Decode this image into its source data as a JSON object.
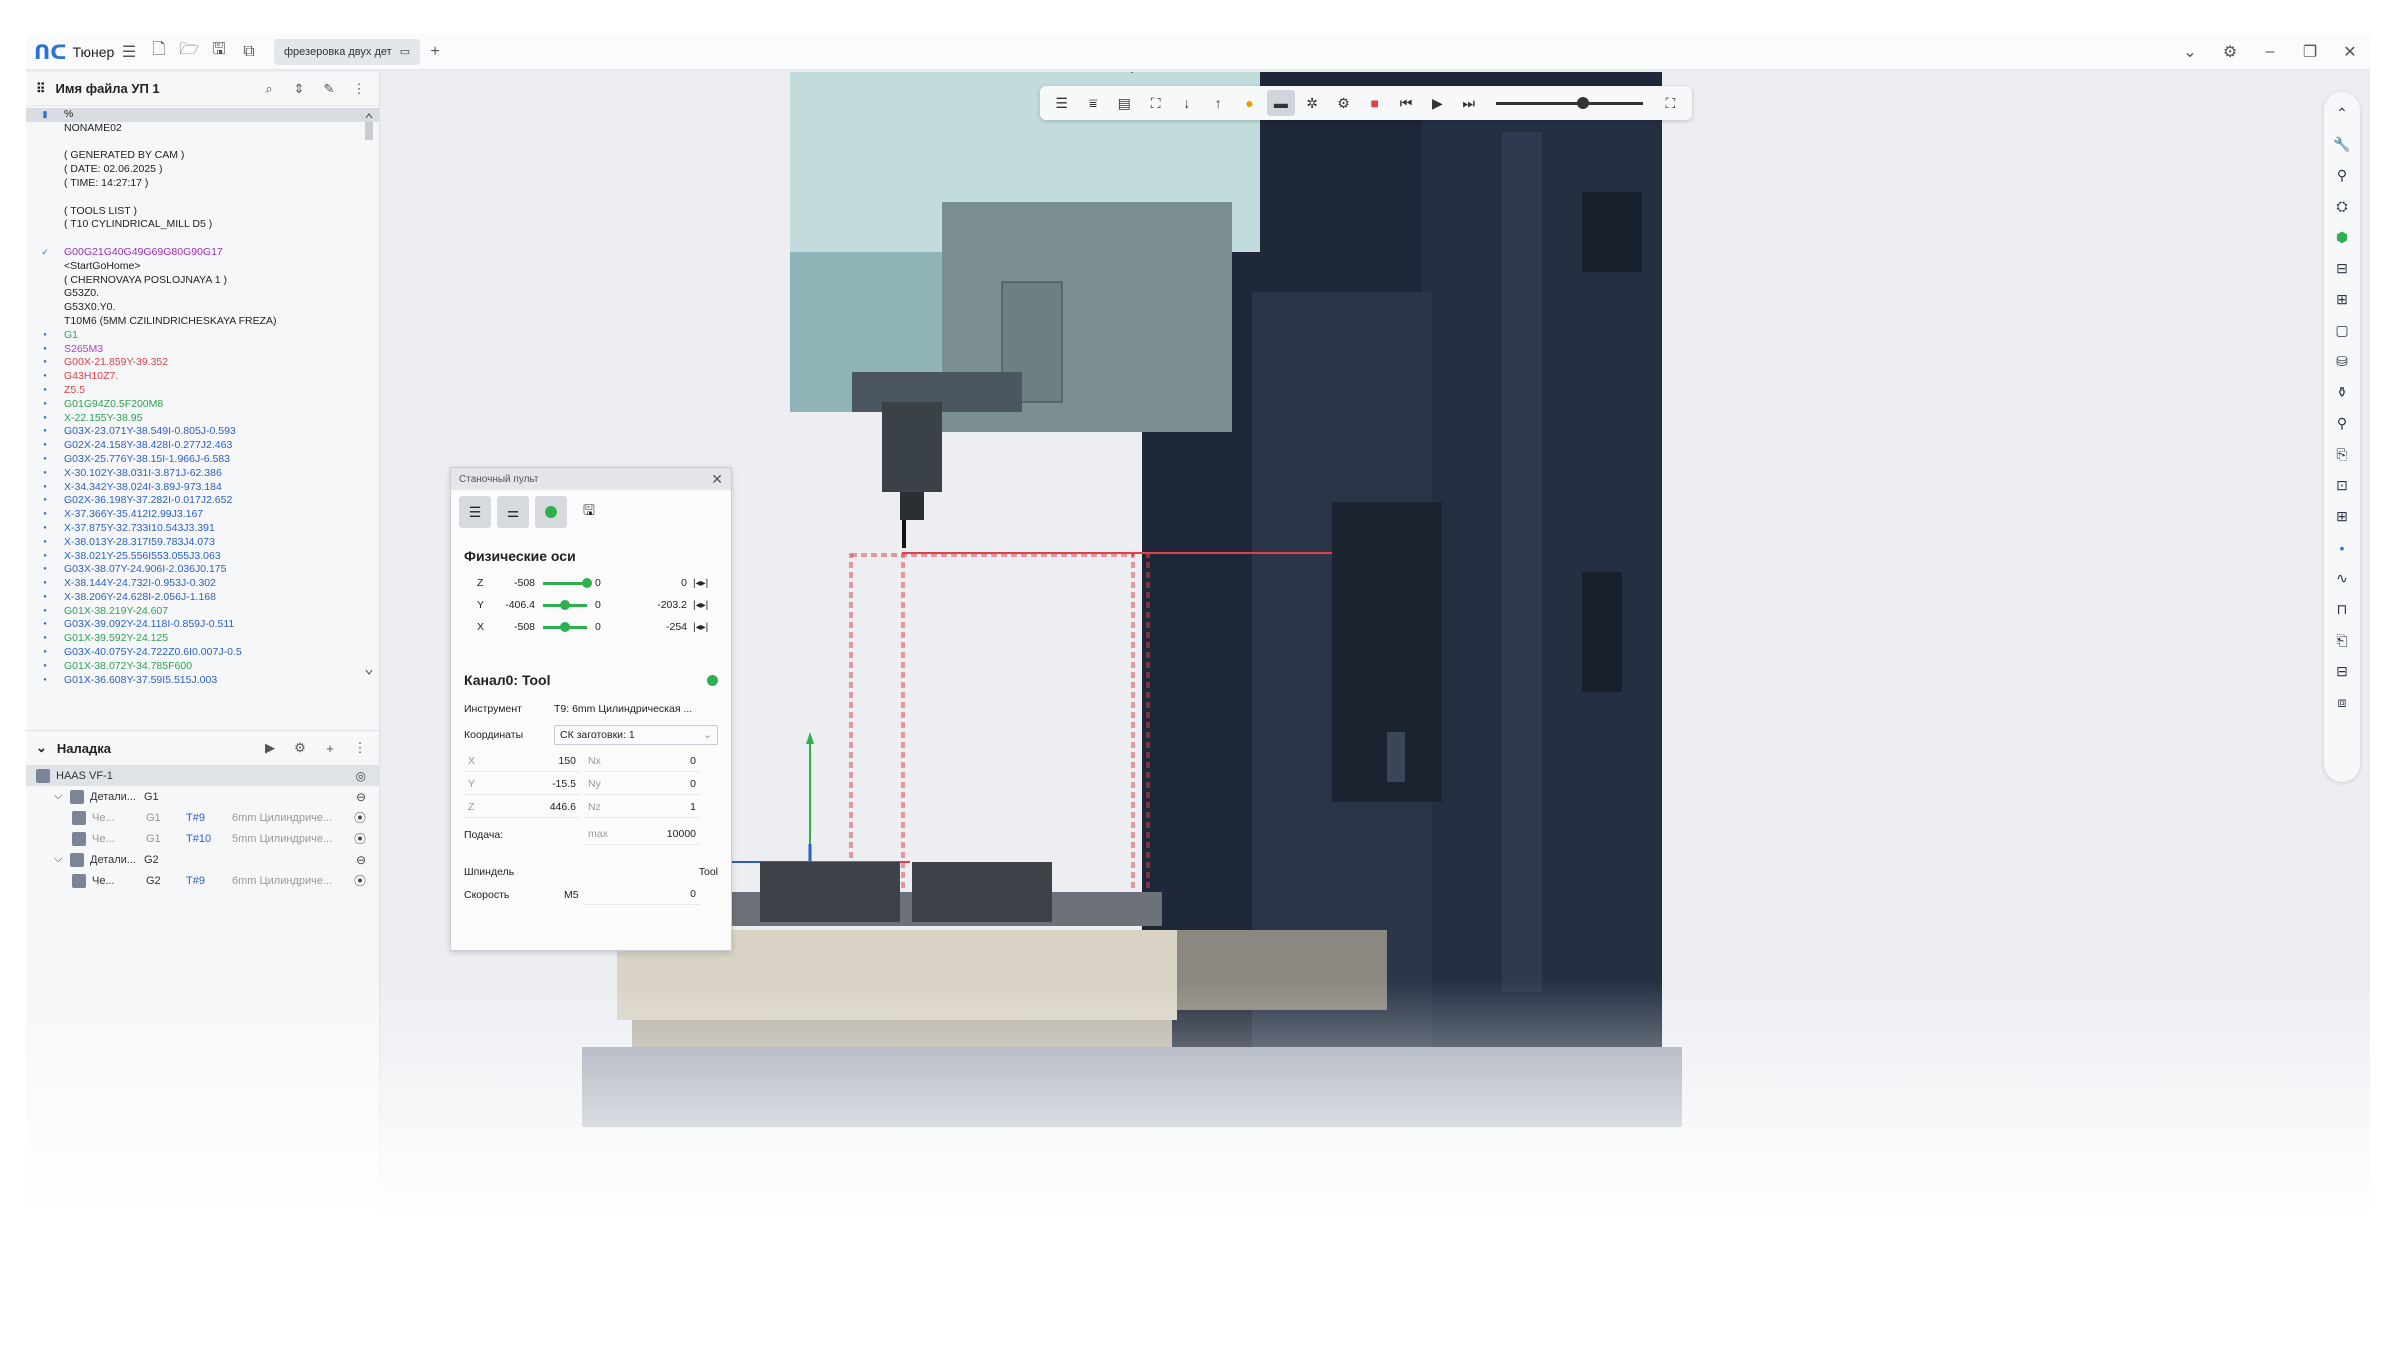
{
  "app": {
    "name": "Тюнер",
    "tab_label": "фрезеровка двух дет"
  },
  "code_panel": {
    "title": "Имя файла УП 1",
    "lines": [
      {
        "text": "%",
        "color": "#222",
        "marker": "bookmark",
        "highlight": true
      },
      {
        "text": "NONAME02",
        "color": "#222"
      },
      {
        "text": "",
        "color": "#222"
      },
      {
        "text": "( GENERATED BY CAM )",
        "color": "#222"
      },
      {
        "text": "( DATE: 02.06.2025 )",
        "color": "#222"
      },
      {
        "text": "( TIME: 14:27:17 )",
        "color": "#222"
      },
      {
        "text": "",
        "color": "#222"
      },
      {
        "text": "( TOOLS LIST )",
        "color": "#222"
      },
      {
        "text": "( T10 CYLINDRICAL_MILL D5 )",
        "color": "#222"
      },
      {
        "text": "",
        "color": "#222"
      },
      {
        "text": "G00G21G40G49G69G80G90G17",
        "color": "#9b2fb8",
        "marker": "check"
      },
      {
        "text": "<StartGoHome>",
        "color": "#222"
      },
      {
        "text": "( CHERNOVAYA POSLOJNAYA 1 )",
        "color": "#222"
      },
      {
        "text": "G53Z0.",
        "color": "#222"
      },
      {
        "text": "G53X0.Y0.",
        "color": "#222"
      },
      {
        "text": "T10M6 (5MM CZILINDRICHESKAYA FREZA)",
        "color": "#222"
      },
      {
        "text": "G1",
        "color": "#2fa050",
        "marker": "dot"
      },
      {
        "text": "S265M3",
        "color": "#b040c0",
        "marker": "dot"
      },
      {
        "text": "G00X-21.859Y-39.352",
        "color": "#e0404a",
        "marker": "dot"
      },
      {
        "text": "G43H10Z7.",
        "color": "#e0404a",
        "marker": "dot"
      },
      {
        "text": "Z5.5",
        "color": "#e0404a",
        "marker": "dot"
      },
      {
        "text": "G01G94Z0.5F200M8",
        "color": "#2fa050",
        "marker": "dot"
      },
      {
        "text": "X-22.155Y-38.95",
        "color": "#2fa050",
        "marker": "dot"
      },
      {
        "text": "G03X-23.071Y-38.549I-0.805J-0.593",
        "color": "#2a5fc4",
        "marker": "dot"
      },
      {
        "text": "G02X-24.158Y-38.428I-0.277J2.463",
        "color": "#2a5fc4",
        "marker": "dot"
      },
      {
        "text": "G03X-25.776Y-38.15I-1.966J-6.583",
        "color": "#2a5fc4",
        "marker": "dot"
      },
      {
        "text": "X-30.102Y-38.031I-3.871J-62.386",
        "color": "#2a5fc4",
        "marker": "dot"
      },
      {
        "text": "X-34.342Y-38.024I-3.89J-973.184",
        "color": "#2a5fc4",
        "marker": "dot"
      },
      {
        "text": "G02X-36.198Y-37.282I-0.017J2.652",
        "color": "#2a5fc4",
        "marker": "dot"
      },
      {
        "text": "X-37.366Y-35.412I2.99J3.167",
        "color": "#2a5fc4",
        "marker": "dot"
      },
      {
        "text": "X-37.875Y-32.733I10.543J3.391",
        "color": "#2a5fc4",
        "marker": "dot"
      },
      {
        "text": "X-38.013Y-28.317I59.783J4.073",
        "color": "#2a5fc4",
        "marker": "dot"
      },
      {
        "text": "X-38.021Y-25.556I553.055J3.063",
        "color": "#2a5fc4",
        "marker": "dot"
      },
      {
        "text": "G03X-38.07Y-24.906I-2.036J0.175",
        "color": "#2a5fc4",
        "marker": "dot"
      },
      {
        "text": "X-38.144Y-24.732I-0.953J-0.302",
        "color": "#2a5fc4",
        "marker": "dot"
      },
      {
        "text": "X-38.206Y-24.628I-2.056J-1.168",
        "color": "#2a5fc4",
        "marker": "dot"
      },
      {
        "text": "G01X-38.219Y-24.607",
        "color": "#2fa050",
        "marker": "dot"
      },
      {
        "text": "G03X-39.092Y-24.118I-0.859J-0.511",
        "color": "#2a5fc4",
        "marker": "dot"
      },
      {
        "text": "G01X-39.592Y-24.125",
        "color": "#2fa050",
        "marker": "dot"
      },
      {
        "text": "G03X-40.075Y-24.722Z0.6I0.007J-0.5",
        "color": "#2a5fc4",
        "marker": "dot"
      },
      {
        "text": "G01X-38.072Y-34.785F600",
        "color": "#2fa050",
        "marker": "dot"
      },
      {
        "text": "G01X-36.608Y-37.59I5.515J.003",
        "color": "#2a5fc4",
        "marker": "dot"
      }
    ]
  },
  "setup_panel": {
    "title": "Наладка",
    "rows": [
      {
        "indent": 0,
        "name": "HAAS VF-1",
        "sel": true,
        "ri": "◎",
        "ic": "machine"
      },
      {
        "indent": 1,
        "caret": "⌵",
        "name": "Детали...",
        "g": "G1",
        "ri": "⊖",
        "ic": "part"
      },
      {
        "indent": 2,
        "name": "Че...",
        "g": "G1",
        "t": "T#9",
        "d": "6mm Цилиндриче...",
        "ri": "⦿",
        "dim": true,
        "ic": "op"
      },
      {
        "indent": 2,
        "name": "Че...",
        "g": "G1",
        "t": "T#10",
        "d": "5mm Цилиндриче...",
        "ri": "⦿",
        "dim": true,
        "ic": "op"
      },
      {
        "indent": 1,
        "caret": "⌵",
        "name": "Детали...",
        "g": "G2",
        "ri": "⊖",
        "ic": "part"
      },
      {
        "indent": 2,
        "name": "Че...",
        "g": "G2",
        "t": "T#9",
        "d": "6mm Цилиндриче...",
        "ri": "⦿",
        "ic": "op"
      }
    ]
  },
  "pult": {
    "title": "Станочный пульт",
    "axes_title": "Физические оси",
    "axes": [
      {
        "name": "Z",
        "value": "-508",
        "zero": "0",
        "box": "0",
        "pos": 1.0
      },
      {
        "name": "Y",
        "value": "-406.4",
        "zero": "0",
        "box": "-203.2",
        "pos": 0.5
      },
      {
        "name": "X",
        "value": "-508",
        "zero": "0",
        "box": "-254",
        "pos": 0.5
      }
    ],
    "channel": "Канал0: Tool",
    "instrument_label": "Инструмент",
    "instrument_value": "T9: 6mm Цилиндрическая ...",
    "coords_label": "Координаты",
    "coords_value": "СК заготовки: 1",
    "coord_rows": [
      {
        "a": "X",
        "av": "150",
        "b": "Nx",
        "bv": "0"
      },
      {
        "a": "Y",
        "av": "-15.5",
        "b": "Ny",
        "bv": "0"
      },
      {
        "a": "Z",
        "av": "446.6",
        "b": "Nz",
        "bv": "1"
      }
    ],
    "feed_label": "Подача:",
    "feed_max": "max",
    "feed_value": "10000",
    "spindle_label": "Шпиндель",
    "spindle_value": "Tool",
    "speed_label": "Скорость",
    "speed_code": "M5",
    "speed_value": "0"
  },
  "colors": {
    "accent": "#2a72d6",
    "green": "#2fb050",
    "red": "#e0404a"
  }
}
